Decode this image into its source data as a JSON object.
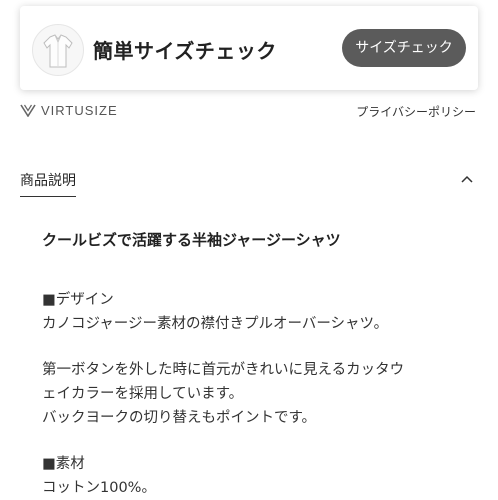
{
  "size_check": {
    "title": "簡単サイズチェック",
    "button_label": "サイズチェック",
    "thumbnail_icon": "shirt-icon"
  },
  "footer_bar": {
    "brand": "VIRTUSIZE",
    "brand_icon": "virtusize-logo-icon",
    "privacy_link": "プライバシーポリシー"
  },
  "section": {
    "tab_label": "商品説明",
    "toggle_icon": "chevron-up-icon"
  },
  "description": {
    "headline": "クールビズで活躍する半袖ジャージーシャツ",
    "design_heading": "■デザイン",
    "design_text": "カノコジャージー素材の襟付きプルオーバーシャツ。",
    "detail_lines": [
      "第一ボタンを外した時に首元がきれいに見えるカッタウ",
      "ェイカラーを採用しています。",
      "バックヨークの切り替えもポイントです。"
    ],
    "material_heading": "■素材",
    "material_text": "コットン100%。"
  },
  "colors": {
    "button_bg": "#5b5b5b",
    "text": "#2a2a2a",
    "underline": "#333333"
  }
}
